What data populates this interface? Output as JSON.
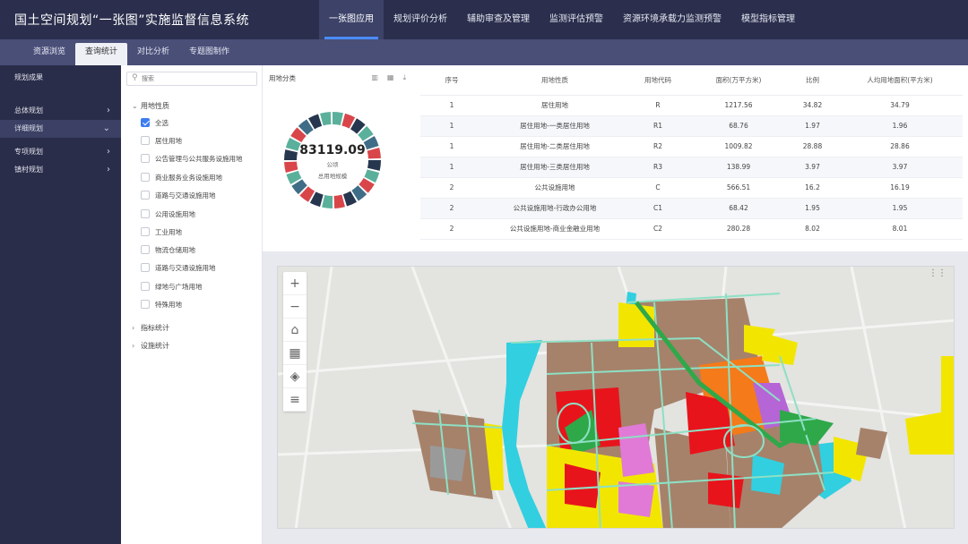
{
  "app": {
    "title": "国土空间规划“一张图”实施监督信息系统"
  },
  "top_nav": [
    {
      "label": "一张图应用",
      "active": true
    },
    {
      "label": "规划评价分析"
    },
    {
      "label": "辅助审查及管理"
    },
    {
      "label": "监测评估预警"
    },
    {
      "label": "资源环境承载力监测预警"
    },
    {
      "label": "模型指标管理"
    }
  ],
  "sub_tabs": [
    {
      "label": "资源浏览"
    },
    {
      "label": "查询统计",
      "active": true
    },
    {
      "label": "对比分析"
    },
    {
      "label": "专题图制作"
    }
  ],
  "sidebar": {
    "items": [
      {
        "label": "规划成果"
      },
      {
        "label": "总体规划",
        "chevron": "›"
      },
      {
        "label": "详细规划",
        "chevron": "⌄",
        "active": true
      },
      {
        "label": "专项规划",
        "chevron": "›"
      },
      {
        "label": "镇村规划",
        "chevron": "›"
      }
    ]
  },
  "filter": {
    "search_placeholder": "搜索",
    "group_label": "用地性质",
    "checkboxes": [
      {
        "label": "全选",
        "checked": true
      },
      {
        "label": "居住用地"
      },
      {
        "label": "公告管理与公共服务设施用地"
      },
      {
        "label": "商业服务业务设施用地"
      },
      {
        "label": "道路与交通设施用地"
      },
      {
        "label": "公用设施用地"
      },
      {
        "label": "工业用地"
      },
      {
        "label": "物流仓储用地"
      },
      {
        "label": "道路与交通设施用地"
      },
      {
        "label": "绿地与广场用地"
      },
      {
        "label": "特殊用地"
      }
    ],
    "collapsed_groups": [
      {
        "label": "指标统计"
      },
      {
        "label": "设施统计"
      }
    ]
  },
  "donut": {
    "title": "用地分类",
    "value": "83119.09",
    "unit": "公顷",
    "label": "总用地规模",
    "colors": {
      "teal": "#5bb09b",
      "red": "#d9464a",
      "navy": "#27364f",
      "steel": "#3f6d87"
    }
  },
  "table": {
    "columns": [
      "序号",
      "用地性质",
      "用地代码",
      "面积(万平方米)",
      "比例",
      "人均用地面积(平方米)"
    ],
    "rows": [
      [
        "1",
        "居住用地",
        "R",
        "1217.56",
        "34.82",
        "34.79"
      ],
      [
        "1",
        "居住用地-一类居住用地",
        "R1",
        "68.76",
        "1.97",
        "1.96"
      ],
      [
        "1",
        "居住用地-二类居住用地",
        "R2",
        "1009.82",
        "28.88",
        "28.86"
      ],
      [
        "1",
        "居住用地-三类居住用地",
        "R3",
        "138.99",
        "3.97",
        "3.97"
      ],
      [
        "2",
        "公共设施用地",
        "C",
        "566.51",
        "16.2",
        "16.19"
      ],
      [
        "2",
        "公共设施用地-行政办公用地",
        "C1",
        "68.42",
        "1.95",
        "1.95"
      ],
      [
        "2",
        "公共设施用地-商业金融业用地",
        "C2",
        "280.28",
        "8.02",
        "8.01"
      ]
    ]
  },
  "map": {
    "tools": [
      {
        "name": "zoom-in-icon",
        "glyph": "+"
      },
      {
        "name": "zoom-out-icon",
        "glyph": "−"
      },
      {
        "name": "home-icon",
        "glyph": "⌂"
      },
      {
        "name": "layers-grid-icon",
        "glyph": "▦"
      },
      {
        "name": "layer-stack-icon",
        "glyph": "◈"
      },
      {
        "name": "menu-icon",
        "glyph": "≡"
      }
    ],
    "basemap_toggle_icon": "⋮⋮",
    "landuse_colors": {
      "residential": "#f2e600",
      "commercial": "#e8141c",
      "public": "#e07ad6",
      "industrial": "#a6826b",
      "green": "#2fa84a",
      "water": "#31cfe0",
      "warehouse": "#b565d6",
      "orange": "#f47a1a",
      "gray": "#9a9a9a",
      "road": "#8ee0c4"
    }
  }
}
